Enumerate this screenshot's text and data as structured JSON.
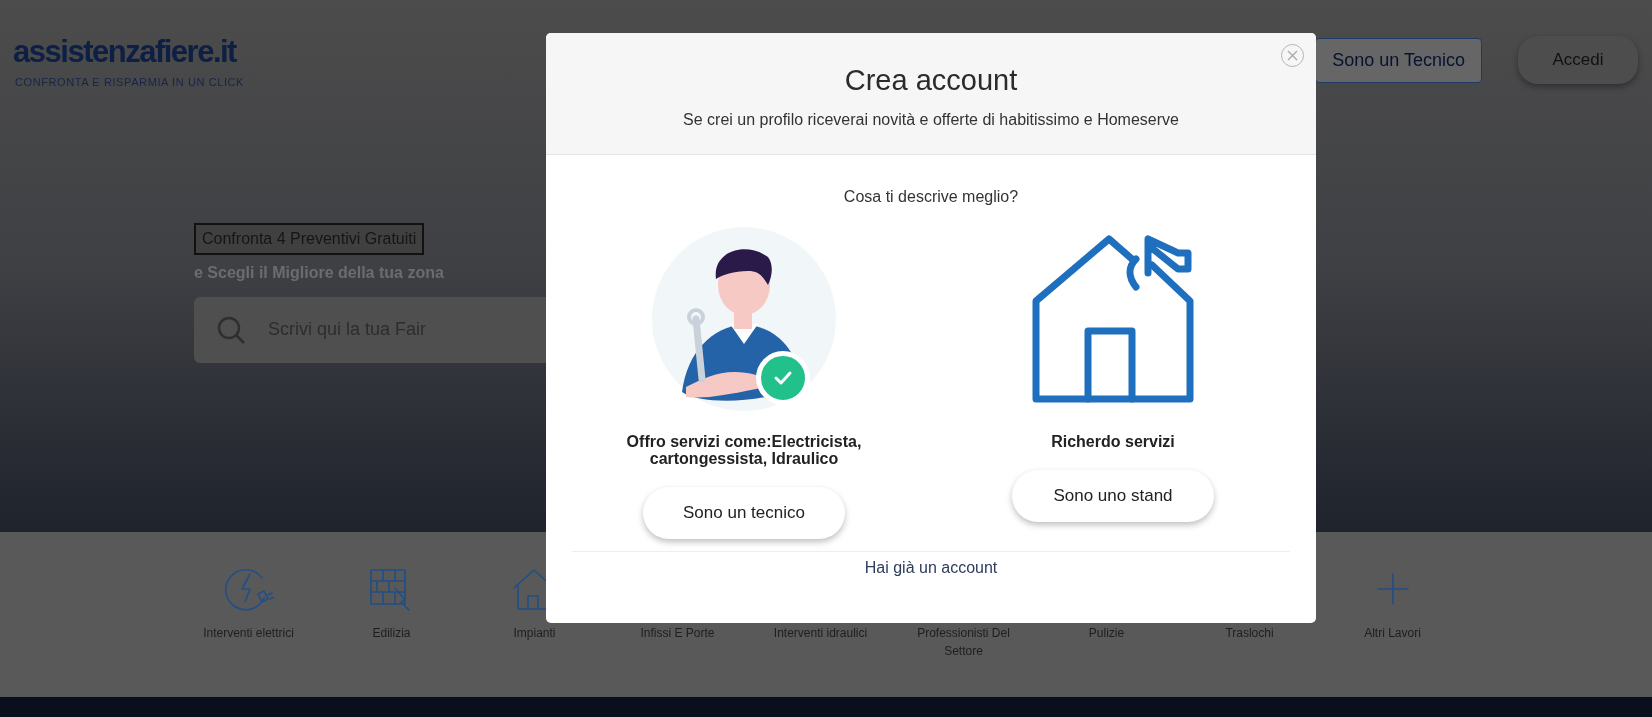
{
  "header": {
    "logo": "assistenzafiere.it",
    "tagline": "CONFRONTA E RISPARMIA IN UN CLICK",
    "buttons": [
      {
        "label": "Sono un Tecnico",
        "kind": "outline"
      },
      {
        "label": "Accedi",
        "kind": "pill"
      }
    ]
  },
  "hero": {
    "heading": "Confronta 4 Preventivi Gratuiti",
    "subheading": "e Scegli il Migliore della tua zona",
    "search": {
      "placeholder": "Scrivi qui la tua Fair"
    }
  },
  "categories": [
    {
      "label": "Interventi elettrici",
      "kind": "bolt"
    },
    {
      "label": "Edilizia",
      "kind": "bricks"
    },
    {
      "label": "Impianti",
      "kind": "house"
    },
    {
      "label": "Infissi E Porte"
    },
    {
      "label": "Interventi idraulici"
    },
    {
      "label": "Professionisti Del Settore"
    },
    {
      "label": "Pulizie"
    },
    {
      "label": "Traslochi"
    },
    {
      "label": "Altri Lavori",
      "kind": "plus"
    }
  ],
  "modal": {
    "title": "Crea account",
    "subtitle": "Se crei un profilo riceverai novità e offerte di habitissimo e Homeserve",
    "question": "Cosa ti descrive meglio?",
    "options": [
      {
        "kind": "worker",
        "label": "Offro servizi come:Electricista, cartongessista, Idraulico",
        "button": "Sono un tecnico",
        "selected": true
      },
      {
        "kind": "house",
        "label": "Richerdo servizi",
        "button": "Sono uno stand",
        "selected": false
      }
    ],
    "login_link": "Hai già un account"
  }
}
